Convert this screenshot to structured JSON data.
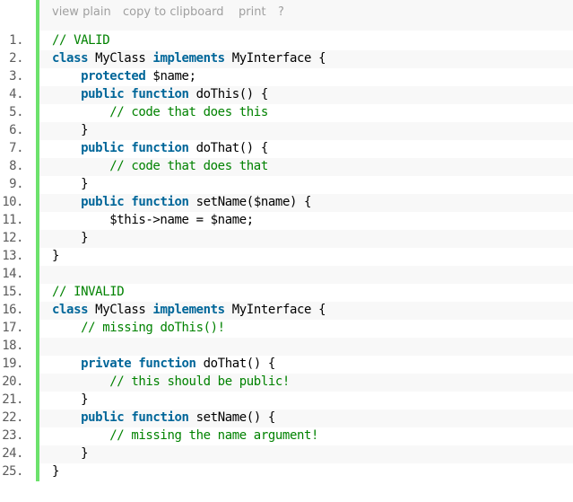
{
  "toolbar": {
    "view_plain": "view plain",
    "copy": "copy to clipboard",
    "print": "print",
    "help": "?"
  },
  "accent_color": "#6ce26c",
  "lines": [
    {
      "n": "1.",
      "tokens": [
        {
          "t": "// VALID",
          "c": "cm"
        }
      ]
    },
    {
      "n": "2.",
      "tokens": [
        {
          "t": "class",
          "c": "kw"
        },
        {
          "t": " MyClass ",
          "c": ""
        },
        {
          "t": "implements",
          "c": "kw"
        },
        {
          "t": " MyInterface {",
          "c": ""
        }
      ]
    },
    {
      "n": "3.",
      "tokens": [
        {
          "t": "    ",
          "c": ""
        },
        {
          "t": "protected",
          "c": "kw"
        },
        {
          "t": " $name;",
          "c": ""
        }
      ]
    },
    {
      "n": "4.",
      "tokens": [
        {
          "t": "    ",
          "c": ""
        },
        {
          "t": "public",
          "c": "kw"
        },
        {
          "t": " ",
          "c": ""
        },
        {
          "t": "function",
          "c": "kw"
        },
        {
          "t": " doThis() {",
          "c": ""
        }
      ]
    },
    {
      "n": "5.",
      "tokens": [
        {
          "t": "        ",
          "c": ""
        },
        {
          "t": "// code that does this",
          "c": "cm"
        }
      ]
    },
    {
      "n": "6.",
      "tokens": [
        {
          "t": "    }",
          "c": ""
        }
      ]
    },
    {
      "n": "7.",
      "tokens": [
        {
          "t": "    ",
          "c": ""
        },
        {
          "t": "public",
          "c": "kw"
        },
        {
          "t": " ",
          "c": ""
        },
        {
          "t": "function",
          "c": "kw"
        },
        {
          "t": " doThat() {",
          "c": ""
        }
      ]
    },
    {
      "n": "8.",
      "tokens": [
        {
          "t": "        ",
          "c": ""
        },
        {
          "t": "// code that does that",
          "c": "cm"
        }
      ]
    },
    {
      "n": "9.",
      "tokens": [
        {
          "t": "    }",
          "c": ""
        }
      ]
    },
    {
      "n": "10.",
      "tokens": [
        {
          "t": "    ",
          "c": ""
        },
        {
          "t": "public",
          "c": "kw"
        },
        {
          "t": " ",
          "c": ""
        },
        {
          "t": "function",
          "c": "kw"
        },
        {
          "t": " setName($name) {",
          "c": ""
        }
      ]
    },
    {
      "n": "11.",
      "tokens": [
        {
          "t": "        $this->name = $name;",
          "c": ""
        }
      ]
    },
    {
      "n": "12.",
      "tokens": [
        {
          "t": "    }",
          "c": ""
        }
      ]
    },
    {
      "n": "13.",
      "tokens": [
        {
          "t": "}",
          "c": ""
        }
      ]
    },
    {
      "n": "14.",
      "tokens": []
    },
    {
      "n": "15.",
      "tokens": [
        {
          "t": "// INVALID",
          "c": "cm"
        }
      ]
    },
    {
      "n": "16.",
      "tokens": [
        {
          "t": "class",
          "c": "kw"
        },
        {
          "t": " MyClass ",
          "c": ""
        },
        {
          "t": "implements",
          "c": "kw"
        },
        {
          "t": " MyInterface {",
          "c": ""
        }
      ]
    },
    {
      "n": "17.",
      "tokens": [
        {
          "t": "    ",
          "c": ""
        },
        {
          "t": "// missing doThis()!",
          "c": "cm"
        }
      ]
    },
    {
      "n": "18.",
      "tokens": []
    },
    {
      "n": "19.",
      "tokens": [
        {
          "t": "    ",
          "c": ""
        },
        {
          "t": "private",
          "c": "kw"
        },
        {
          "t": " ",
          "c": ""
        },
        {
          "t": "function",
          "c": "kw"
        },
        {
          "t": " doThat() {",
          "c": ""
        }
      ]
    },
    {
      "n": "20.",
      "tokens": [
        {
          "t": "        ",
          "c": ""
        },
        {
          "t": "// this should be public!",
          "c": "cm"
        }
      ]
    },
    {
      "n": "21.",
      "tokens": [
        {
          "t": "    }",
          "c": ""
        }
      ]
    },
    {
      "n": "22.",
      "tokens": [
        {
          "t": "    ",
          "c": ""
        },
        {
          "t": "public",
          "c": "kw"
        },
        {
          "t": " ",
          "c": ""
        },
        {
          "t": "function",
          "c": "kw"
        },
        {
          "t": " setName() {",
          "c": ""
        }
      ]
    },
    {
      "n": "23.",
      "tokens": [
        {
          "t": "        ",
          "c": ""
        },
        {
          "t": "// missing the name argument!",
          "c": "cm"
        }
      ]
    },
    {
      "n": "24.",
      "tokens": [
        {
          "t": "    }",
          "c": ""
        }
      ]
    },
    {
      "n": "25.",
      "tokens": [
        {
          "t": "}",
          "c": ""
        }
      ]
    }
  ]
}
